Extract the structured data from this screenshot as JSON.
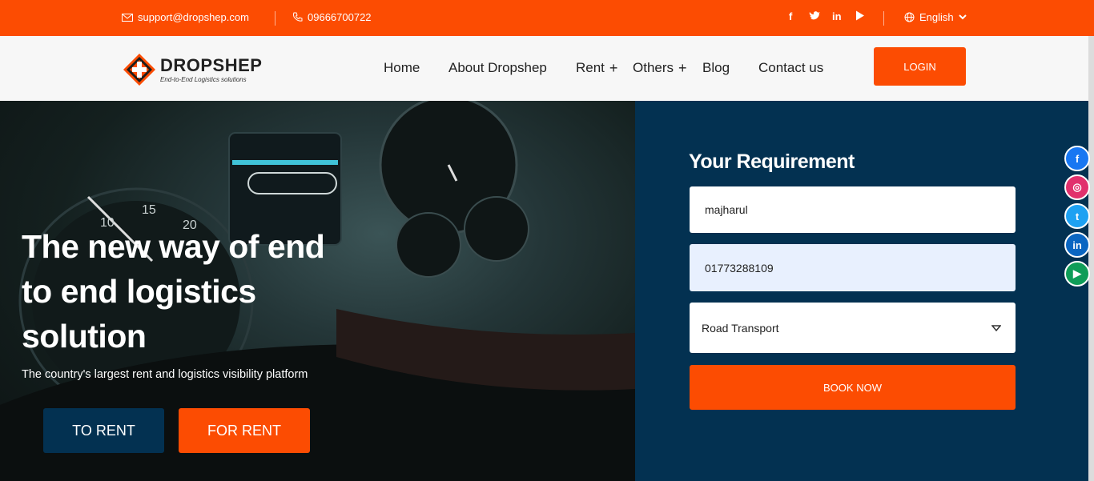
{
  "topbar": {
    "email": "support@dropshep.com",
    "phone": "09666700722",
    "language": "English",
    "socials": [
      "facebook-icon",
      "twitter-icon",
      "linkedin-icon",
      "play-store-icon"
    ]
  },
  "brand": {
    "name": "DROPSHEP",
    "tagline": "End-to-End Logistics solutions"
  },
  "nav": {
    "home": "Home",
    "about": "About Dropshep",
    "rent": "Rent",
    "others": "Others",
    "blog": "Blog",
    "contact": "Contact us",
    "plus": "+",
    "login": "LOGIN"
  },
  "hero": {
    "title": "The new way of end to end logistics solution",
    "subtitle": "The country's largest rent and logistics visibility platform",
    "to_rent": "TO RENT",
    "for_rent": "FOR RENT"
  },
  "form": {
    "title": "Your Requirement",
    "name_value": "majharul",
    "phone_value": "01773288109",
    "transport_selected": "Road Transport",
    "book_now": "BOOK NOW"
  },
  "side_social": [
    {
      "icon": "facebook-icon",
      "color": "#1877f2",
      "glyph": "f"
    },
    {
      "icon": "instagram-icon",
      "color": "#e1306c",
      "glyph": "◎"
    },
    {
      "icon": "twitter-icon",
      "color": "#1da1f2",
      "glyph": "t"
    },
    {
      "icon": "linkedin-icon",
      "color": "#0a66c2",
      "glyph": "in"
    },
    {
      "icon": "play-store-icon",
      "color": "#0f9d58",
      "glyph": "▶"
    }
  ],
  "colors": {
    "accent": "#fc4c02",
    "navy": "#033151"
  }
}
